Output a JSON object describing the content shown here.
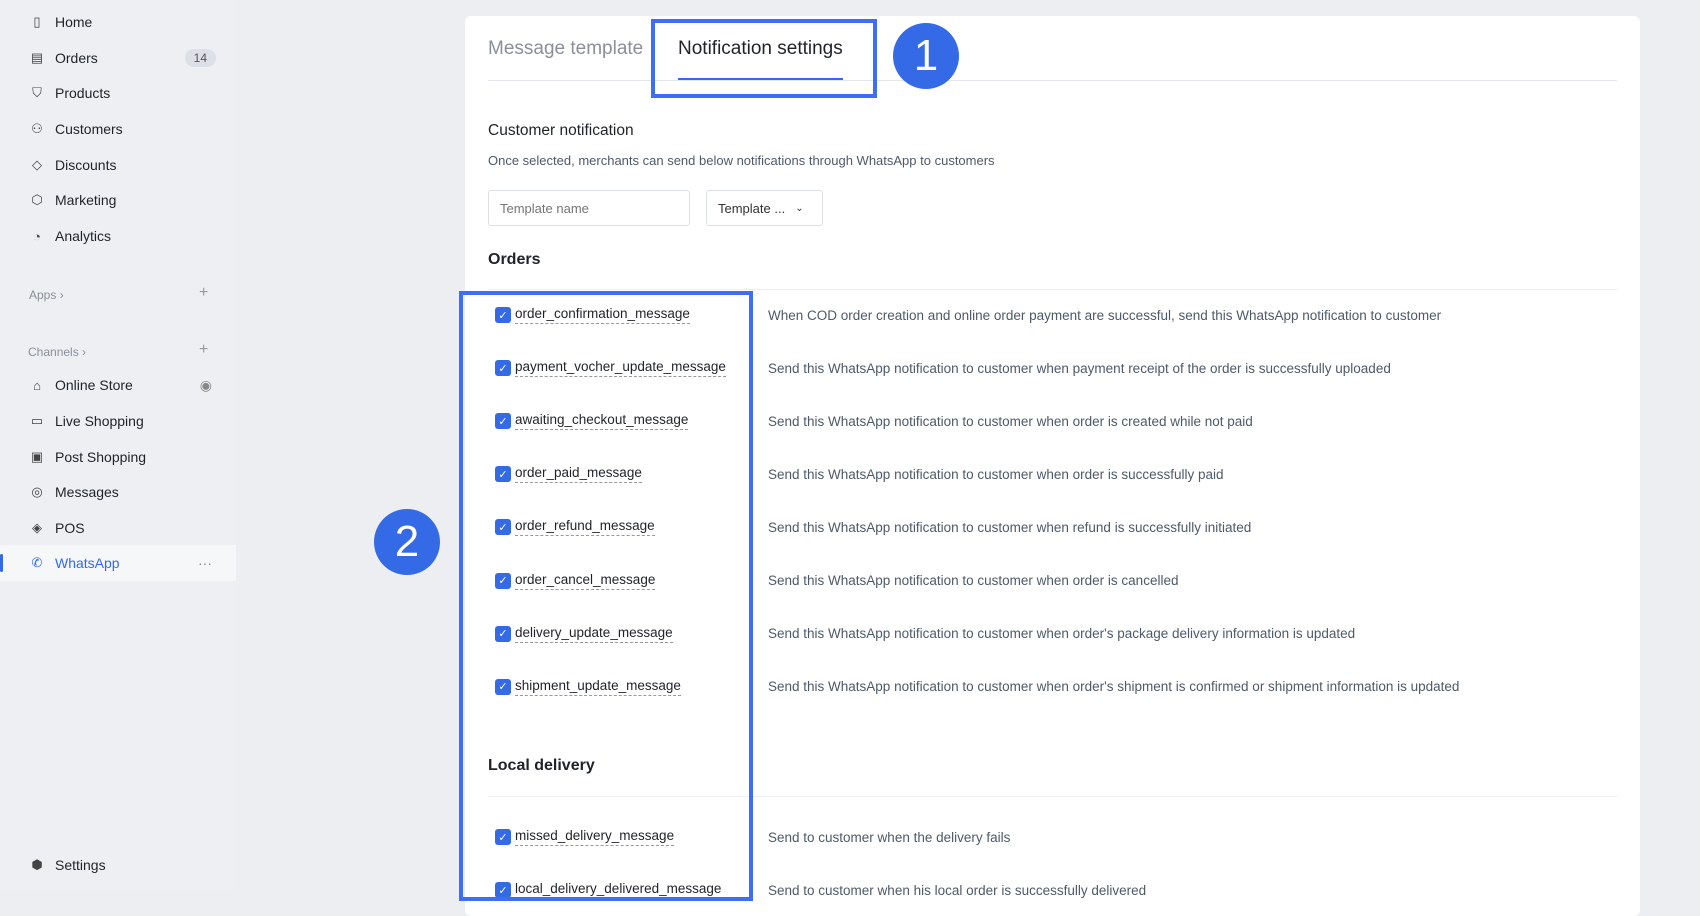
{
  "sidebar": {
    "items": [
      {
        "label": "Home",
        "icon": "layout-icon"
      },
      {
        "label": "Orders",
        "icon": "orders-icon",
        "badge": "14"
      },
      {
        "label": "Products",
        "icon": "bag-icon"
      },
      {
        "label": "Customers",
        "icon": "user-icon"
      },
      {
        "label": "Discounts",
        "icon": "tag-icon"
      },
      {
        "label": "Marketing",
        "icon": "cube-icon"
      },
      {
        "label": "Analytics",
        "icon": "pie-icon"
      }
    ],
    "apps_label": "Apps",
    "channels_label": "Channels",
    "channels": [
      {
        "label": "Online Store",
        "icon": "store-icon"
      },
      {
        "label": "Live Shopping",
        "icon": "video-icon"
      },
      {
        "label": "Post Shopping",
        "icon": "image-icon"
      },
      {
        "label": "Messages",
        "icon": "chat-icon"
      },
      {
        "label": "POS",
        "icon": "pos-icon"
      },
      {
        "label": "WhatsApp",
        "icon": "whatsapp-icon",
        "active": true
      }
    ],
    "settings_label": "Settings"
  },
  "tabs": [
    {
      "label": "Message template"
    },
    {
      "label": "Notification settings",
      "active": true
    }
  ],
  "customer_notification": {
    "title": "Customer notification",
    "description": "Once selected, merchants can send below notifications through WhatsApp to customers",
    "template_name_placeholder": "Template name",
    "template_select": "Template ..."
  },
  "orders": {
    "title": "Orders",
    "rows": [
      {
        "name": "order_confirmation_message",
        "desc": "When COD order creation and online order payment are successful, send this WhatsApp notification to customer",
        "checked": true
      },
      {
        "name": "payment_vocher_update_message",
        "desc": "Send this WhatsApp notification to customer when payment receipt of the order is successfully uploaded",
        "checked": true
      },
      {
        "name": "awaiting_checkout_message",
        "desc": "Send this WhatsApp notification to customer when order is created while not paid",
        "checked": true
      },
      {
        "name": "order_paid_message",
        "desc": "Send this WhatsApp notification to customer when order is successfully paid",
        "checked": true
      },
      {
        "name": "order_refund_message",
        "desc": "Send this WhatsApp notification to customer when refund is successfully initiated",
        "checked": true
      },
      {
        "name": "order_cancel_message",
        "desc": "Send this WhatsApp notification to customer when order is cancelled",
        "checked": true
      },
      {
        "name": "delivery_update_message",
        "desc": "Send this WhatsApp notification to customer when order's package delivery information is updated",
        "checked": true
      },
      {
        "name": "shipment_update_message",
        "desc": "Send this WhatsApp notification to customer when order's shipment is confirmed or shipment information is updated",
        "checked": true
      }
    ]
  },
  "local_delivery": {
    "title": "Local delivery",
    "rows": [
      {
        "name": "missed_delivery_message",
        "desc": "Send to customer when the delivery fails",
        "checked": true
      },
      {
        "name": "local_delivery_delivered_message",
        "desc": "Send to customer when his local order is successfully delivered",
        "checked": true
      }
    ]
  },
  "annotations": {
    "one": "1",
    "two": "2",
    "color": "#3d6ef5"
  },
  "accent": "#356ae6"
}
